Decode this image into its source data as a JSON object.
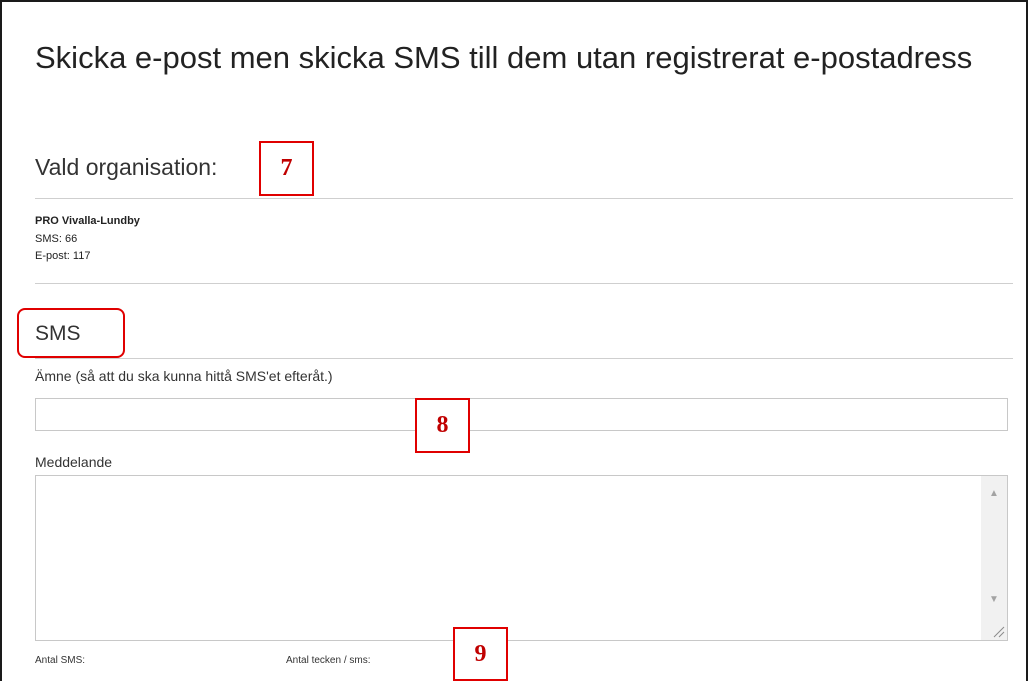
{
  "page": {
    "title": "Skicka e-post men skicka SMS till dem utan registrerat e-postadress"
  },
  "organisation": {
    "heading": "Vald organisation:",
    "name": "PRO Vivalla-Lundby",
    "sms_line": "SMS: 66",
    "email_line": "E-post: 117"
  },
  "sms": {
    "heading": "SMS",
    "subject_label": "Ämne (så att du ska kunna hittå SMS'et efteråt.)",
    "subject_value": "",
    "message_label": "Meddelande",
    "message_value": "",
    "count_label": "Antal SMS:",
    "chars_label": "Antal tecken / sms:"
  },
  "annotations": {
    "marker_7": "7",
    "marker_8": "8",
    "marker_9": "9",
    "color": "#e00000"
  },
  "icons": {
    "scroll_up": "triangle-up-icon",
    "scroll_down": "triangle-down-icon",
    "resize": "resize-grip-icon"
  }
}
